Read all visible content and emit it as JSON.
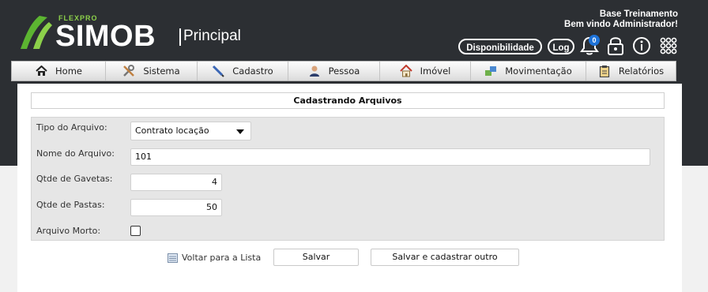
{
  "brand": {
    "tagline": "FLEXPRO",
    "name": "SIMOB",
    "section": "Principal"
  },
  "user": {
    "line1": "Base Treinamento",
    "line2": "Bem vindo Administrador!"
  },
  "toolbar": {
    "disponibilidade": "Disponibilidade",
    "log": "Log",
    "notifications_count": "0"
  },
  "menu": [
    {
      "label": "Home",
      "icon": "home-icon"
    },
    {
      "label": "Sistema",
      "icon": "tools-icon"
    },
    {
      "label": "Cadastro",
      "icon": "pencil-icon"
    },
    {
      "label": "Pessoa",
      "icon": "person-icon"
    },
    {
      "label": "Imóvel",
      "icon": "house-icon"
    },
    {
      "label": "Movimentação",
      "icon": "exchange-icon"
    },
    {
      "label": "Relatórios",
      "icon": "clipboard-icon"
    }
  ],
  "form": {
    "title": "Cadastrando Arquivos",
    "tipo_label": "Tipo do Arquivo:",
    "tipo_value": "Contrato locação",
    "nome_label": "Nome do Arquivo:",
    "nome_value": "101",
    "gavetas_label": "Qtde de Gavetas:",
    "gavetas_value": "4",
    "pastas_label": "Qtde de Pastas:",
    "pastas_value": "50",
    "morto_label": "Arquivo Morto:",
    "morto_checked": false
  },
  "actions": {
    "voltar": "Voltar para a Lista",
    "salvar": "Salvar",
    "salvar_outro": "Salvar e cadastrar outro"
  }
}
